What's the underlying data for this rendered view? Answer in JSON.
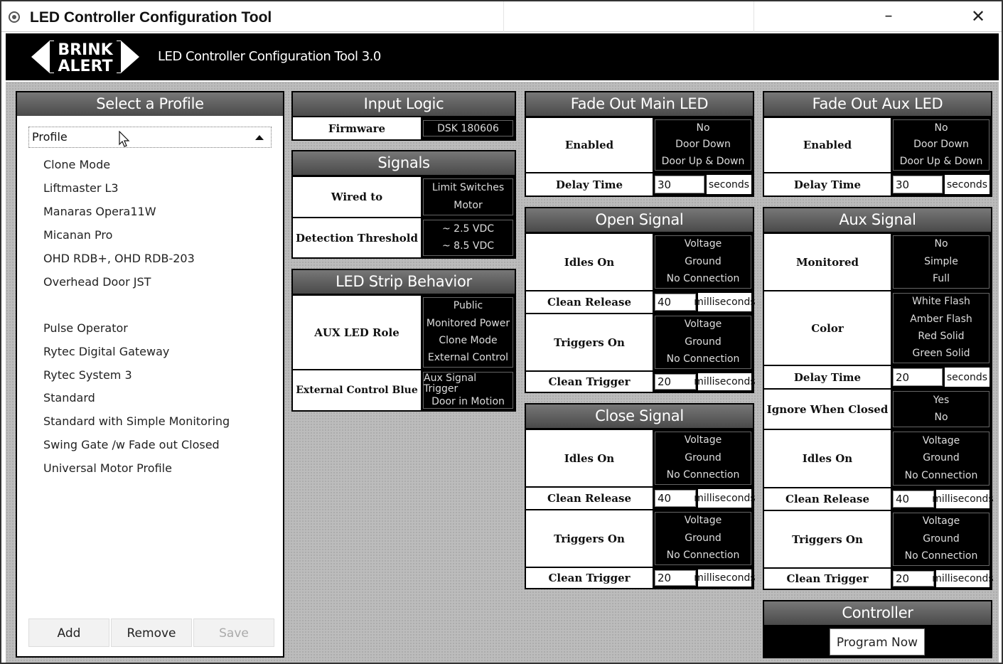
{
  "window": {
    "title": "LED Controller Configuration Tool",
    "minimize": "–",
    "close": "✕"
  },
  "header": {
    "logo_top": "BRINK",
    "logo_bottom": "ALERT",
    "subtitle": "LED Controller Configuration Tool 3.0"
  },
  "profile": {
    "title": "Select a Profile",
    "dropdown_value": "Profile",
    "items": [
      "Clone Mode",
      "Liftmaster L3",
      "Manaras Opera11W",
      "Micanan Pro",
      "OHD RDB+, OHD RDB-203",
      "Overhead Door JST",
      "",
      "Pulse Operator",
      "Rytec Digital Gateway",
      "Rytec System 3",
      "Standard",
      "Standard with Simple Monitoring",
      "Swing Gate /w Fade out Closed",
      "Universal Motor Profile"
    ],
    "add": "Add",
    "remove": "Remove",
    "save": "Save"
  },
  "input_logic": {
    "title": "Input Logic",
    "firmware_label": "Firmware",
    "firmware_value": "DSK 180606"
  },
  "signals": {
    "title": "Signals",
    "wired_label": "Wired to",
    "wired_options": [
      "Limit Switches",
      "Motor"
    ],
    "threshold_label": "Detection Threshold",
    "threshold_options": [
      "~ 2.5 VDC",
      "~ 8.5 VDC"
    ]
  },
  "led_strip": {
    "title": "LED Strip Behavior",
    "aux_role_label": "AUX LED Role",
    "aux_role_options": [
      "Public",
      "Monitored Power",
      "Clone Mode",
      "External Control"
    ],
    "ext_label": "External Control Blue",
    "ext_options": [
      "Aux Signal Trigger",
      "Door in Motion"
    ]
  },
  "fade_main": {
    "title": "Fade Out Main LED",
    "enabled_label": "Enabled",
    "enabled_options": [
      "No",
      "Door Down",
      "Door Up & Down"
    ],
    "delay_label": "Delay Time",
    "delay_value": "30",
    "delay_unit": "seconds"
  },
  "fade_aux": {
    "title": "Fade Out Aux LED",
    "enabled_label": "Enabled",
    "enabled_options": [
      "No",
      "Door Down",
      "Door Up & Down"
    ],
    "delay_label": "Delay Time",
    "delay_value": "30",
    "delay_unit": "seconds"
  },
  "open_signal": {
    "title": "Open Signal",
    "idles_label": "Idles On",
    "idles_options": [
      "Voltage",
      "Ground",
      "No Connection"
    ],
    "release_label": "Clean Release",
    "release_value": "40",
    "release_unit": "milliseconds",
    "triggers_label": "Triggers On",
    "triggers_options": [
      "Voltage",
      "Ground",
      "No Connection"
    ],
    "trigger_label": "Clean Trigger",
    "trigger_value": "20",
    "trigger_unit": "milliseconds"
  },
  "close_signal": {
    "title": "Close Signal",
    "idles_label": "Idles On",
    "idles_options": [
      "Voltage",
      "Ground",
      "No Connection"
    ],
    "release_label": "Clean Release",
    "release_value": "40",
    "release_unit": "milliseconds",
    "triggers_label": "Triggers On",
    "triggers_options": [
      "Voltage",
      "Ground",
      "No Connection"
    ],
    "trigger_label": "Clean Trigger",
    "trigger_value": "20",
    "trigger_unit": "milliseconds"
  },
  "aux_signal": {
    "title": "Aux Signal",
    "monitored_label": "Monitored",
    "monitored_options": [
      "No",
      "Simple",
      "Full"
    ],
    "color_label": "Color",
    "color_options": [
      "White Flash",
      "Amber Flash",
      "Red Solid",
      "Green Solid"
    ],
    "delay_label": "Delay Time",
    "delay_value": "20",
    "delay_unit": "seconds",
    "ignore_label": "Ignore When Closed",
    "ignore_options": [
      "Yes",
      "No"
    ],
    "idles_label": "Idles On",
    "idles_options": [
      "Voltage",
      "Ground",
      "No Connection"
    ],
    "release_label": "Clean Release",
    "release_value": "40",
    "release_unit": "milliseconds",
    "triggers_label": "Triggers On",
    "triggers_options": [
      "Voltage",
      "Ground",
      "No Connection"
    ],
    "trigger_label": "Clean Trigger",
    "trigger_value": "20",
    "trigger_unit": "milliseconds"
  },
  "controller": {
    "title": "Controller",
    "program": "Program Now"
  }
}
